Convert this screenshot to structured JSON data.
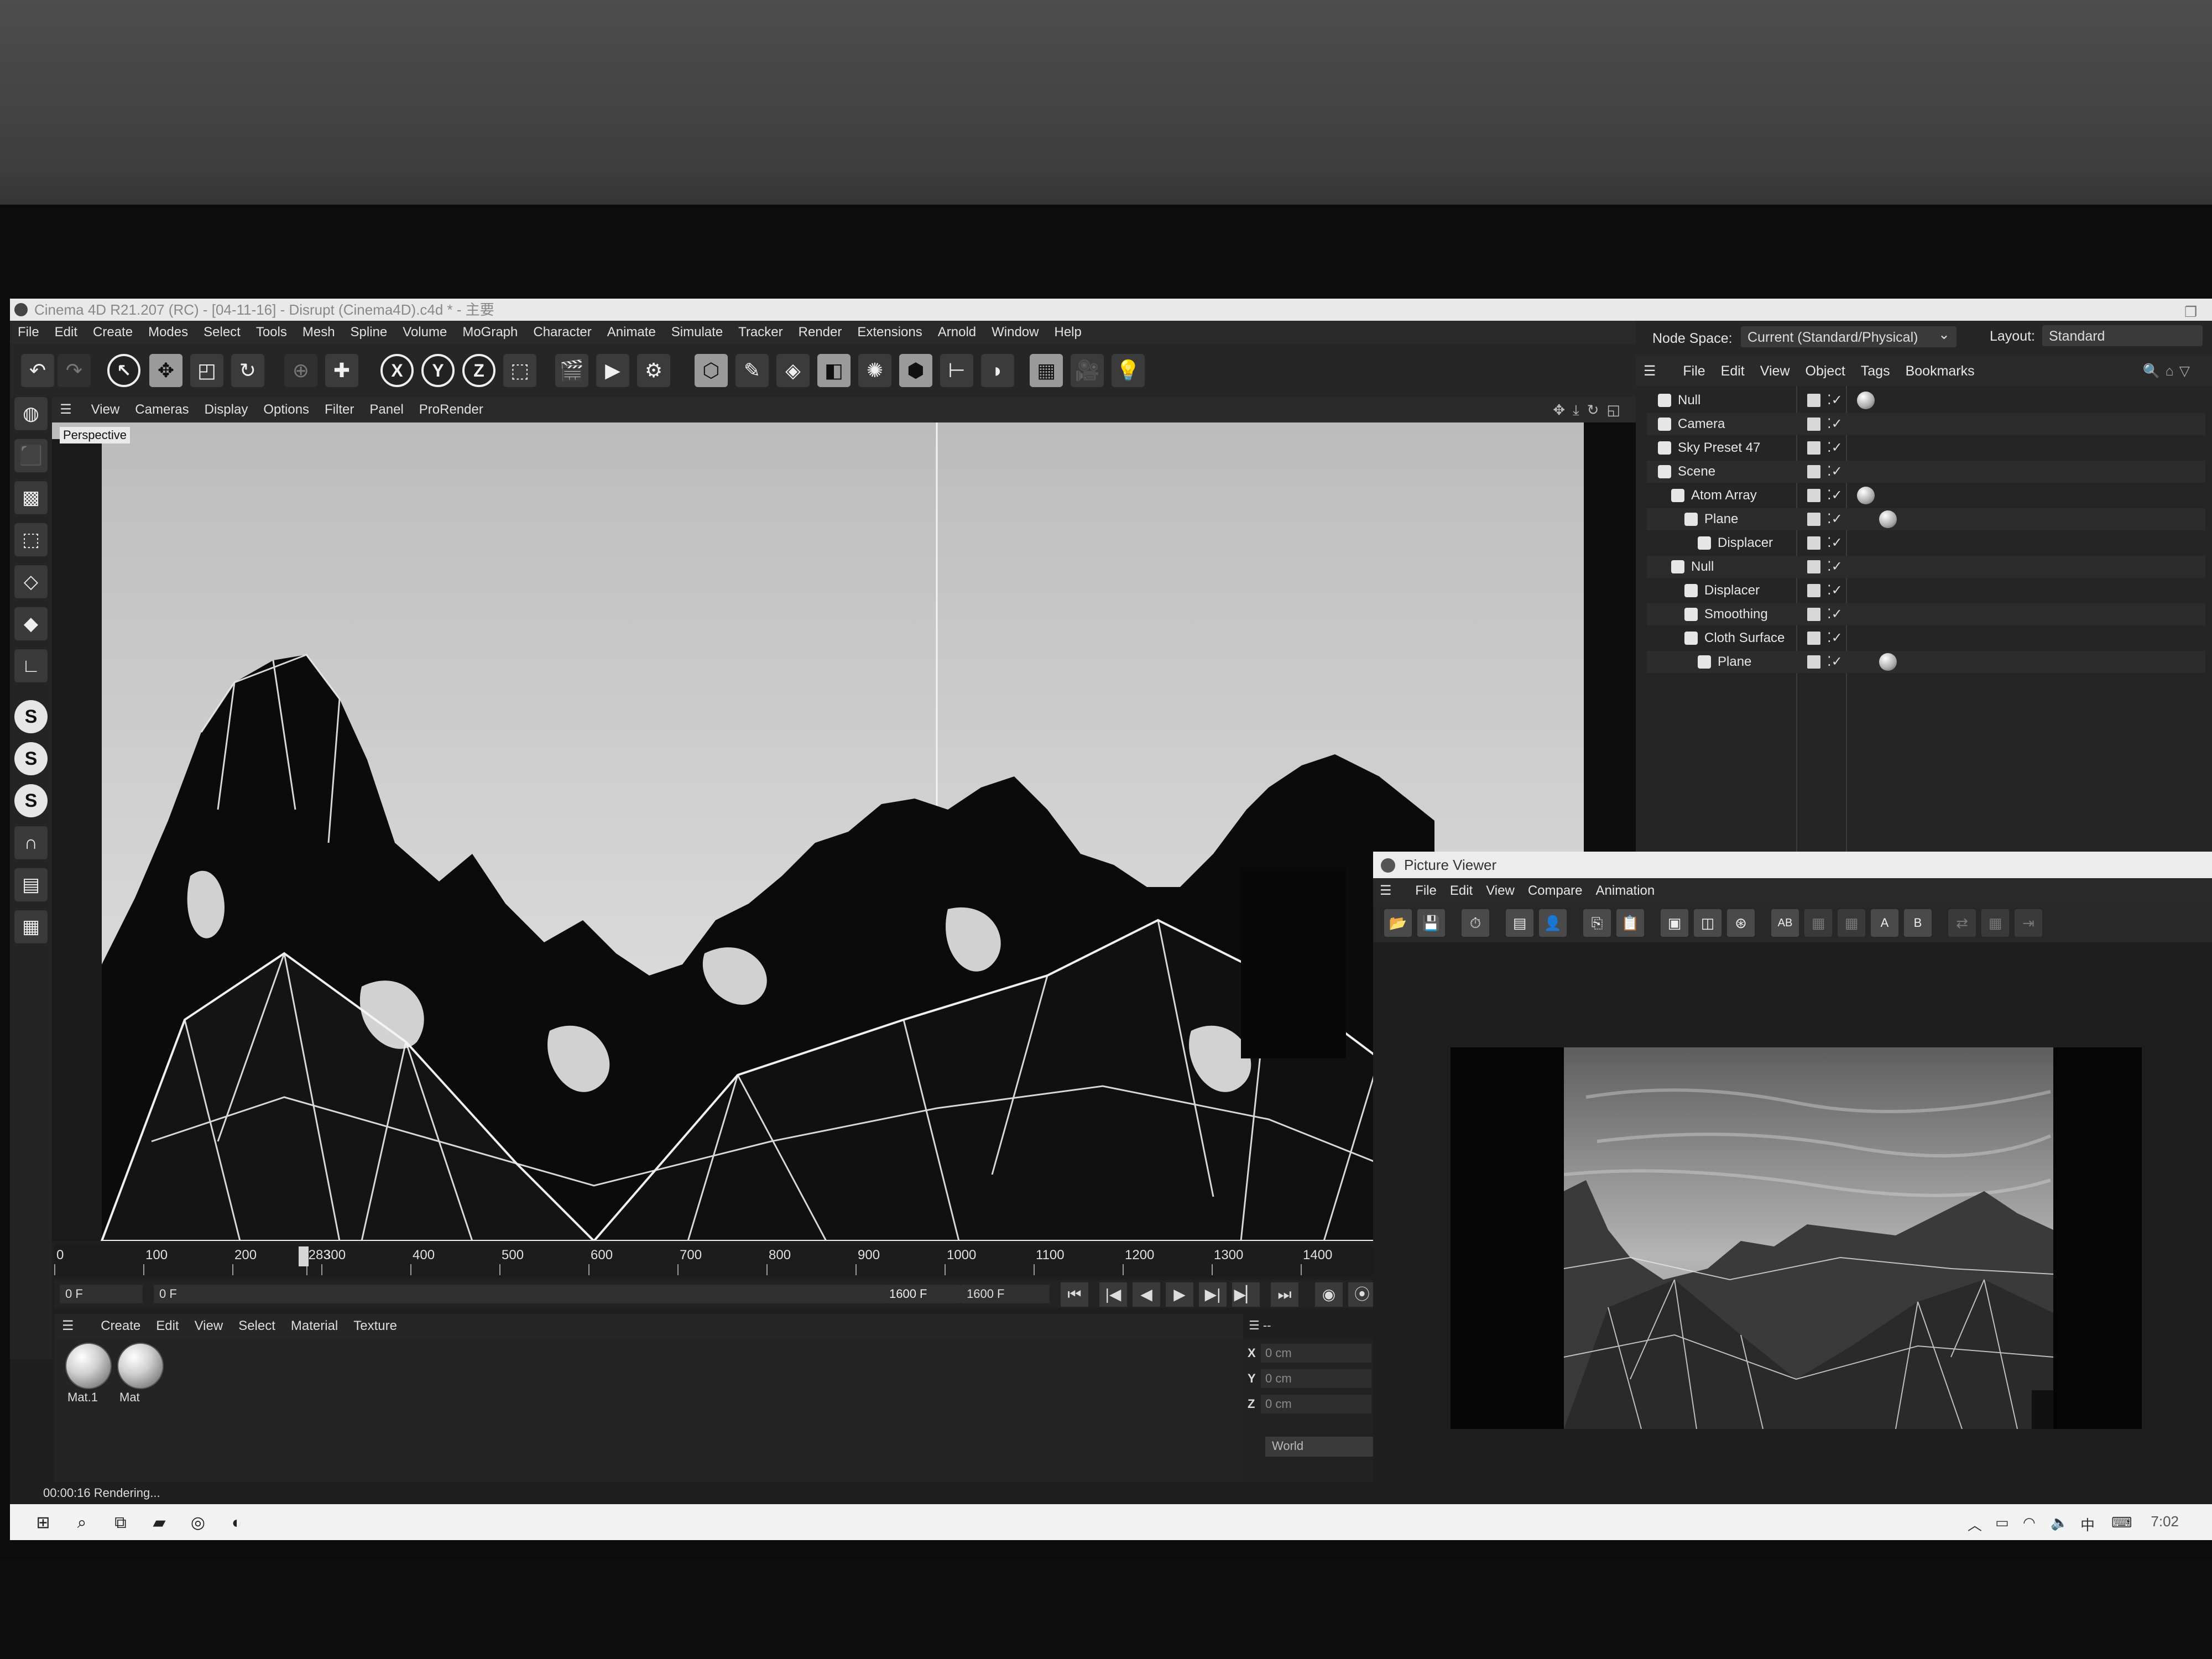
{
  "window": {
    "title": "Cinema 4D R21.207 (RC) - [04-11-16] - Disrupt (Cinema4D).c4d * - 主要"
  },
  "menu": [
    "File",
    "Edit",
    "Create",
    "Modes",
    "Select",
    "Tools",
    "Mesh",
    "Spline",
    "Volume",
    "MoGraph",
    "Character",
    "Animate",
    "Simulate",
    "Tracker",
    "Render",
    "Extensions",
    "Arnold",
    "Window",
    "Help"
  ],
  "node_space": {
    "label": "Node Space:",
    "value": "Current (Standard/Physical)",
    "layout_label": "Layout:",
    "layout_value": "Standard"
  },
  "toolbar": {
    "icons": [
      "undo-icon",
      "redo-icon",
      "select-icon",
      "move-icon",
      "scale-icon",
      "rotate-icon",
      "snap-icon",
      "add-icon",
      "x-axis-icon",
      "y-axis-icon",
      "z-axis-icon",
      "coordinate-system-icon",
      "render-region-icon",
      "render-view-icon",
      "render-settings-icon",
      "cube-icon",
      "pen-icon",
      "subdivision-icon",
      "extrude-icon",
      "cloner-icon",
      "array-icon",
      "bend-icon",
      "field-icon",
      "floor-icon",
      "camera-icon",
      "light-icon"
    ],
    "x_label": "X",
    "y_label": "Y",
    "z_label": "Z"
  },
  "viewport": {
    "menu": [
      "View",
      "Cameras",
      "Display",
      "Options",
      "Filter",
      "Panel",
      "ProRender"
    ],
    "label": "Perspective"
  },
  "timeline": {
    "ticks": [
      "0",
      "100",
      "200",
      "283",
      "300",
      "400",
      "500",
      "600",
      "700",
      "800",
      "900",
      "1000",
      "1100",
      "1200",
      "1300",
      "1400"
    ],
    "current_frame": 283,
    "start": "0 F",
    "range_start": "0 F",
    "range_end": "1600 F",
    "end": "1600 F"
  },
  "material_manager": {
    "menu": [
      "Create",
      "Edit",
      "View",
      "Select",
      "Material",
      "Texture"
    ],
    "materials": [
      {
        "name": "Mat.1"
      },
      {
        "name": "Mat"
      }
    ]
  },
  "coordinates": {
    "header": "--",
    "rows": [
      {
        "axis": "X",
        "value": "0 cm"
      },
      {
        "axis": "Y",
        "value": "0 cm"
      },
      {
        "axis": "Z",
        "value": "0 cm"
      }
    ],
    "space": "World"
  },
  "status": {
    "text": "00:00:16 Rendering..."
  },
  "object_manager": {
    "menu": [
      "File",
      "Edit",
      "View",
      "Object",
      "Tags",
      "Bookmarks"
    ],
    "objects": [
      {
        "name": "Null",
        "depth": 0,
        "has_tag": true
      },
      {
        "name": "Camera",
        "depth": 0,
        "has_tag": false
      },
      {
        "name": "Sky Preset 47",
        "depth": 0,
        "has_tag": false
      },
      {
        "name": "Scene",
        "depth": 0,
        "has_tag": false
      },
      {
        "name": "Atom Array",
        "depth": 1,
        "has_tag": true
      },
      {
        "name": "Plane",
        "depth": 2,
        "has_tag": true
      },
      {
        "name": "Displacer",
        "depth": 3,
        "has_tag": false
      },
      {
        "name": "Null",
        "depth": 1,
        "has_tag": false
      },
      {
        "name": "Displacer",
        "depth": 2,
        "has_tag": false
      },
      {
        "name": "Smoothing",
        "depth": 2,
        "has_tag": false
      },
      {
        "name": "Cloth Surface",
        "depth": 2,
        "has_tag": false
      },
      {
        "name": "Plane",
        "depth": 3,
        "has_tag": true
      }
    ]
  },
  "picture_viewer": {
    "title": "Picture Viewer",
    "menu": [
      "File",
      "Edit",
      "View",
      "Compare",
      "Animation"
    ],
    "tools": [
      "open-icon",
      "save-icon",
      "stopwatch-icon",
      "layers-icon",
      "user-icon",
      "copy-icon",
      "paste-icon",
      "frame-icon",
      "frame-alt-icon",
      "render-icon",
      "ab-compare-icon",
      "a-icon",
      "b-icon",
      "swap-icon",
      "grid-icon"
    ],
    "ab_label": "AB",
    "a_label": "A",
    "b_label": "B"
  },
  "taskbar": {
    "time": "7:02",
    "ime": "中",
    "icons": [
      "windows-start-icon",
      "search-icon",
      "task-view-icon",
      "file-explorer-icon",
      "chrome-icon",
      "cinema4d-icon"
    ]
  },
  "colors": {
    "ui_dark": "#262626",
    "viewport_sky": "#cfcfcf",
    "accent_light": "#e6e6e6"
  }
}
